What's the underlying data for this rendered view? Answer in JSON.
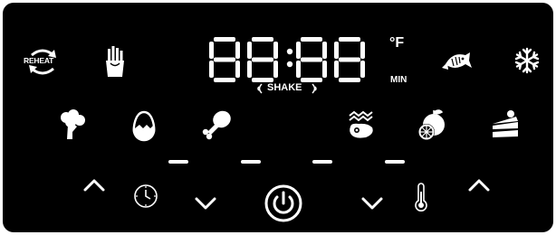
{
  "colors": {
    "panel": "#000000",
    "foreground": "#ffffff",
    "page": "#ffffff"
  },
  "display": {
    "digits": "88:88",
    "unit_temp": "°F",
    "unit_time": "MIN",
    "shake_label": "SHAKE"
  },
  "modes": {
    "reheat_label": "REHEAT",
    "top_row": [
      "reheat-icon",
      "fries-icon",
      "fish-icon",
      "snowflake-icon"
    ],
    "middle_row": [
      "broccoli-icon",
      "egg-icon",
      "chicken-leg-icon",
      "steak-icon",
      "fruit-icon",
      "cake-icon"
    ]
  },
  "controls": [
    "time-up-icon",
    "clock-icon",
    "time-down-icon",
    "power-icon",
    "temp-down-icon",
    "thermometer-icon",
    "temp-up-icon"
  ],
  "indicators": {
    "count": 4
  }
}
